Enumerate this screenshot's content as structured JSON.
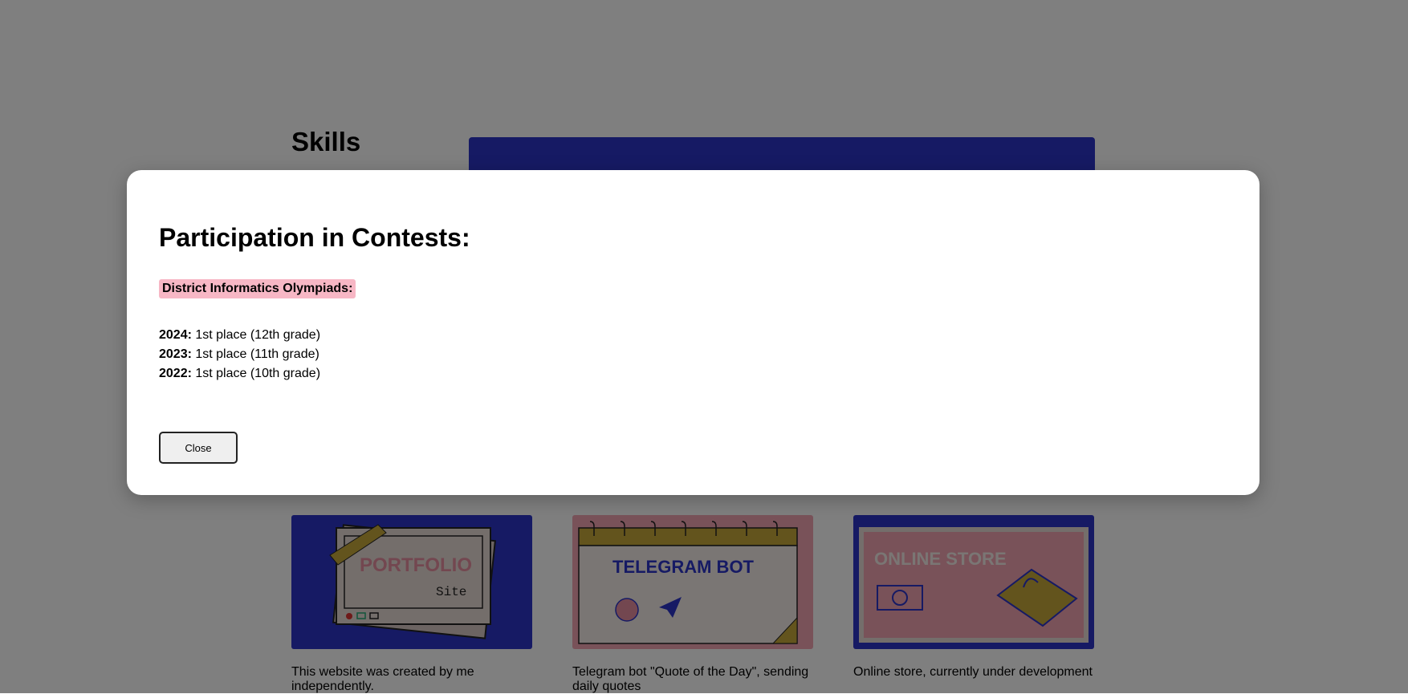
{
  "background": {
    "skills_title": "Skills",
    "projects": [
      {
        "thumbnail_text": "PORTFOLIO",
        "thumbnail_subtext": "Site",
        "description": "This website was created by me independently."
      },
      {
        "thumbnail_text": "TELEGRAM BOT",
        "description": "Telegram bot \"Quote of the Day\", sending daily quotes"
      },
      {
        "thumbnail_text": "ONLINE STORE",
        "description": "Online store, currently under development"
      }
    ]
  },
  "modal": {
    "title": "Participation in Contests:",
    "badge": "District Informatics Olympiads:",
    "results": [
      {
        "year": "2024:",
        "text": " 1st place (12th grade)"
      },
      {
        "year": "2023:",
        "text": " 1st place (11th grade)"
      },
      {
        "year": "2022:",
        "text": " 1st place (10th grade)"
      }
    ],
    "close_label": "Close"
  },
  "colors": {
    "overlay": "rgba(0,0,0,0.5)",
    "blue": "#2c35c9",
    "pink": "#f7b7c5",
    "mustard": "#c7a93a"
  }
}
